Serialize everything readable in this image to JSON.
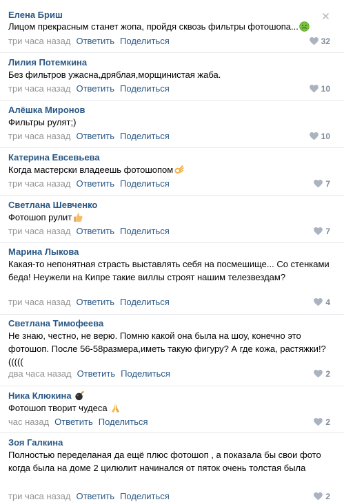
{
  "colors": {
    "author": "#2a5885",
    "meta": "#939393",
    "likes": "#828a99",
    "divider": "#e7e8ec"
  },
  "comments": [
    {
      "author": "Елена Бриш",
      "text": "Лицом прекрасным станет жопа, пройдя сквозь фильтры фотошопа...",
      "emoji": "nauseated-face-icon",
      "time": "три часа назад",
      "reply": "Ответить",
      "share": "Поделиться",
      "likes": "32"
    },
    {
      "author": "Лилия Потемкина",
      "text": "Без фильтров ужасна,дряблая,морщинистая жаба.",
      "time": "три часа назад",
      "reply": "Ответить",
      "share": "Поделиться",
      "likes": "10"
    },
    {
      "author": "Алёшка Миронов",
      "text": "Фильтры рулят;)",
      "time": "три часа назад",
      "reply": "Ответить",
      "share": "Поделиться",
      "likes": "10"
    },
    {
      "author": "Катерина Евсевьева",
      "text": "Когда мастерски владеешь фотошопом",
      "emoji": "ok-hand-icon",
      "time": "три часа назад",
      "reply": "Ответить",
      "share": "Поделиться",
      "likes": "7"
    },
    {
      "author": "Светлана Шевченко",
      "text": "Фотошоп рулит",
      "emoji": "thumbs-up-icon",
      "time": "три часа назад",
      "reply": "Ответить",
      "share": "Поделиться",
      "likes": "7"
    },
    {
      "author": "Марина Лыкова",
      "text": "Какая-то непонятная страсть выставлять себя на посмешище... Со стенками беда! Неужели на Кипре такие виллы строят нашим телезвездам?",
      "time": "три часа назад",
      "reply": "Ответить",
      "share": "Поделиться",
      "likes": "4"
    },
    {
      "author": "Светлана Тимофеева",
      "text": "Не знаю, честно, не верю. Помню какой она была на шоу, конечно это фотошоп. После 56-58размера,иметь такую фигуру? А где кожа, растяжки!?(((((",
      "time": "два часа назад",
      "reply": "Ответить",
      "share": "Поделиться",
      "likes": "2"
    },
    {
      "author": "Ника Клюкина",
      "author_emoji": "bomb-icon",
      "text": "Фотошоп творит чудеса",
      "emoji": "folded-hands-icon",
      "time": "час назад",
      "reply": "Ответить",
      "share": "Поделиться",
      "likes": "2"
    },
    {
      "author": "Зоя Галкина",
      "text": "Полностью переделаная да ещё плюс фотошоп , а показала бы свои фото когда была на доме 2 цилюлит начинался от пяток очень толстая была",
      "time": "три часа назад",
      "reply": "Ответить",
      "share": "Поделиться",
      "likes": "2"
    }
  ]
}
